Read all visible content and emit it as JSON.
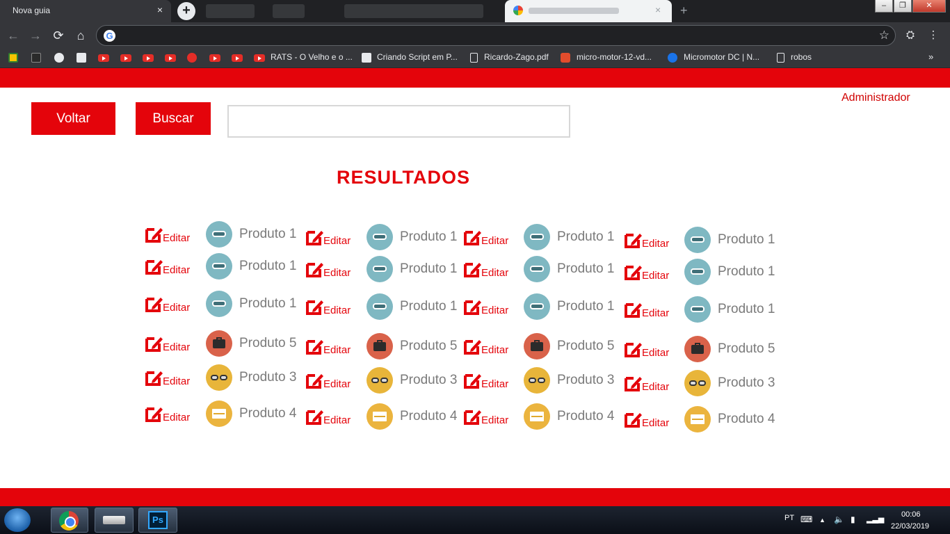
{
  "browser": {
    "active_tab": {
      "title": "Nova guia",
      "close": "×"
    },
    "new_tab": "+",
    "toolbar": {
      "back": "←",
      "forward": "→",
      "reload": "⟳",
      "home": "⌂",
      "star": "☆",
      "menu": "⋮"
    },
    "bookmarks": [
      {
        "label": "RATS - O Velho e o ..."
      },
      {
        "label": "Criando Script em P..."
      },
      {
        "label": "Ricardo-Zago.pdf"
      },
      {
        "label": "micro-motor-12-vd..."
      },
      {
        "label": "Micromotor DC | N..."
      },
      {
        "label": "robos"
      }
    ],
    "bookmarks_more": "»"
  },
  "page": {
    "admin_link": "Administrador",
    "voltar_label": "Voltar",
    "buscar_label": "Buscar",
    "search_value": "",
    "heading": "RESULTADOS",
    "edit_label": "Editar",
    "accent_color": "#e4040b",
    "product_colors": {
      "Produto 1": "#7fb8c2",
      "Produto 5": "#d9624a",
      "Produto 3": "#e8b53a",
      "Produto 4": "#ebb43e"
    },
    "product_icons": {
      "Produto 1": "link-icon",
      "Produto 5": "briefcase-icon",
      "Produto 3": "glasses-icon",
      "Produto 4": "envelope-icon"
    },
    "results": [
      [
        "Produto 1",
        "Produto 1",
        "Produto 1",
        "Produto 1"
      ],
      [
        "Produto 1",
        "Produto 1",
        "Produto 1",
        "Produto 1"
      ],
      [
        "Produto 1",
        "Produto 1",
        "Produto 1",
        "Produto 1"
      ],
      [
        "Produto 5",
        "Produto 5",
        "Produto 5",
        "Produto 5"
      ],
      [
        "Produto 3",
        "Produto 3",
        "Produto 3",
        "Produto 3"
      ],
      [
        "Produto 4",
        "Produto 4",
        "Produto 4",
        "Produto 4"
      ]
    ]
  },
  "taskbar": {
    "language": "PT",
    "time": "00:06",
    "date": "22/03/2019",
    "ps_label": "Ps"
  }
}
